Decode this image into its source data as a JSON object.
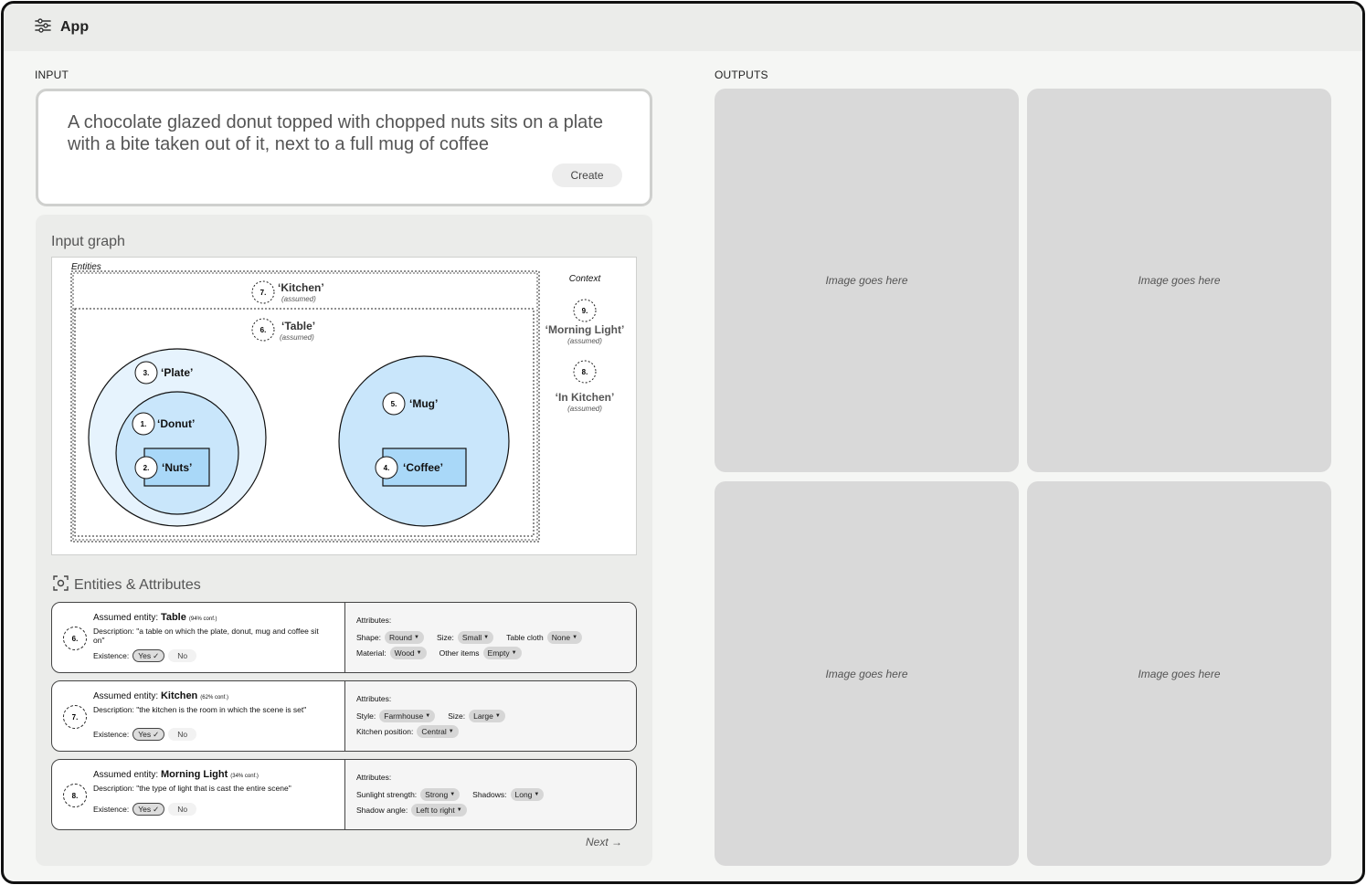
{
  "app": {
    "title": "App",
    "menu_icon": "sliders-icon"
  },
  "input": {
    "section_label": "INPUT",
    "prompt": "A chocolate glazed donut topped with chopped nuts sits on a plate with a bite taken out of it, next to a full mug of coffee",
    "create_label": "Create"
  },
  "graph": {
    "title": "Input graph",
    "entities_label": "Entities",
    "context_label": "Context",
    "kitchen": {
      "num": "7.",
      "name": "‘Kitchen’",
      "note": "(assumed)"
    },
    "table": {
      "num": "6.",
      "name": "‘Table’",
      "note": "(assumed)"
    },
    "plate": {
      "num": "3.",
      "name": "‘Plate’"
    },
    "donut": {
      "num": "1.",
      "name": "‘Donut’"
    },
    "nuts": {
      "num": "2.",
      "name": "‘Nuts’"
    },
    "mug": {
      "num": "5.",
      "name": "‘Mug’"
    },
    "coffee": {
      "num": "4.",
      "name": "‘Coffee’"
    },
    "morning_light": {
      "num": "9.",
      "name": "‘Morning Light’",
      "note": "(assumed)"
    },
    "in_kitchen": {
      "num": "8.",
      "name": "‘In Kitchen’",
      "note": "(assumed)"
    }
  },
  "entities": {
    "title": "Entities & Attributes",
    "icon": "scan-focus-icon",
    "cards": [
      {
        "num": "6.",
        "prefix": "Assumed entity:",
        "name": "Table",
        "conf": "(94% conf.)",
        "description": "Description: \"a table on which the plate, donut, mug and coffee sit on\"",
        "existence_label": "Existence:",
        "yes": "Yes",
        "no": "No",
        "attributes_label": "Attributes:",
        "row1": [
          {
            "label": "Shape:",
            "value": "Round"
          },
          {
            "label": "Size:",
            "value": "Small"
          },
          {
            "label": "Table cloth",
            "value": "None"
          }
        ],
        "row2": [
          {
            "label": "Material:",
            "value": "Wood"
          },
          {
            "label": "Other items",
            "value": "Empty"
          }
        ]
      },
      {
        "num": "7.",
        "prefix": "Assumed entity:",
        "name": "Kitchen",
        "conf": "(62% conf.)",
        "description": "Description: \"the kitchen is the room in which the scene is set\"",
        "existence_label": "Existence:",
        "yes": "Yes",
        "no": "No",
        "attributes_label": "Attributes:",
        "row1": [
          {
            "label": "Style:",
            "value": "Farmhouse"
          },
          {
            "label": "Size:",
            "value": "Large"
          }
        ],
        "row2": [
          {
            "label": "Kitchen position:",
            "value": "Central"
          }
        ]
      },
      {
        "num": "8.",
        "prefix": "Assumed entity:",
        "name": "Morning Light",
        "conf": "(34% conf.)",
        "description": "Description: \"the type of light that is cast the entire scene\"",
        "existence_label": "Existence:",
        "yes": "Yes",
        "no": "No",
        "attributes_label": "Attributes:",
        "row1": [
          {
            "label": "Sunlight strength:",
            "value": "Strong"
          },
          {
            "label": "Shadows:",
            "value": "Long"
          }
        ],
        "row2": [
          {
            "label": "Shadow angle:",
            "value": "Left to right"
          }
        ]
      }
    ],
    "next_label": "Next →"
  },
  "outputs": {
    "section_label": "OUTPUTS",
    "tiles": [
      "Image goes here",
      "Image goes here",
      "Image goes here",
      "Image goes here"
    ]
  },
  "colors": {
    "node_fill_light": "#e6f3fd",
    "node_fill": "#c9e6fb",
    "node_fill_inner": "#a9d8f8"
  }
}
